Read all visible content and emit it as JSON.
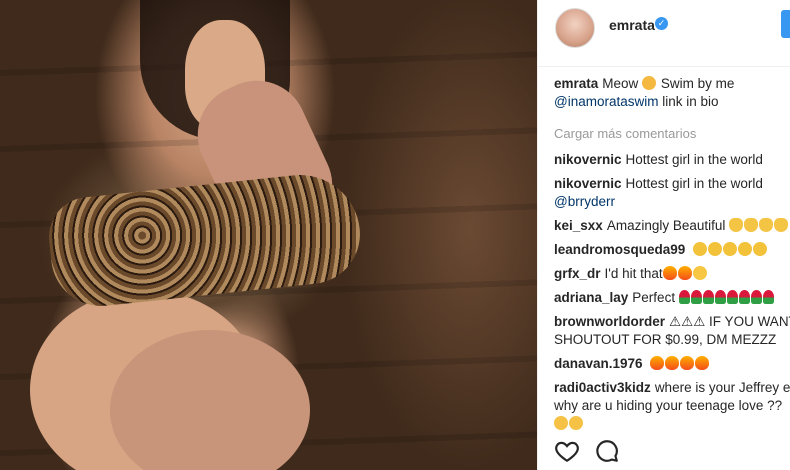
{
  "post": {
    "username": "emrata",
    "verified": true,
    "caption_text": "Meow",
    "caption_text2": "Swim by me",
    "caption_mention": "@inamorataswim",
    "caption_tail": "link in bio",
    "load_more": "Cargar más comentarios"
  },
  "comments": [
    {
      "user": "nikovernic",
      "text": "Hottest girl in the world"
    },
    {
      "user": "nikovernic",
      "text": "Hottest girl in the world",
      "mention": "@brryderr"
    },
    {
      "user": "kei_sxx",
      "text": "Amazingly Beautiful"
    },
    {
      "user": "leandromosqueda99",
      "text": ""
    },
    {
      "user": "grfx_dr",
      "text": "I'd hit that"
    },
    {
      "user": "adriana_lay",
      "text": "Perfect"
    },
    {
      "user": "brownworldorder",
      "text": "⚠⚠⚠ IF YOU WANT",
      "text2": "SHOUTOUT FOR $0.99, DM MEZZZ"
    },
    {
      "user": "danavan.1976",
      "text": ""
    },
    {
      "user": "radi0activ3kidz",
      "text": "where is your Jeffrey e",
      "text2": "why are u hiding your teenage love ??"
    }
  ],
  "icons": [
    "heart-icon",
    "comment-icon",
    "verified-badge-icon"
  ],
  "colors": {
    "accent": "#3897f0",
    "text": "#262626",
    "muted": "#999999",
    "link": "#003569"
  }
}
